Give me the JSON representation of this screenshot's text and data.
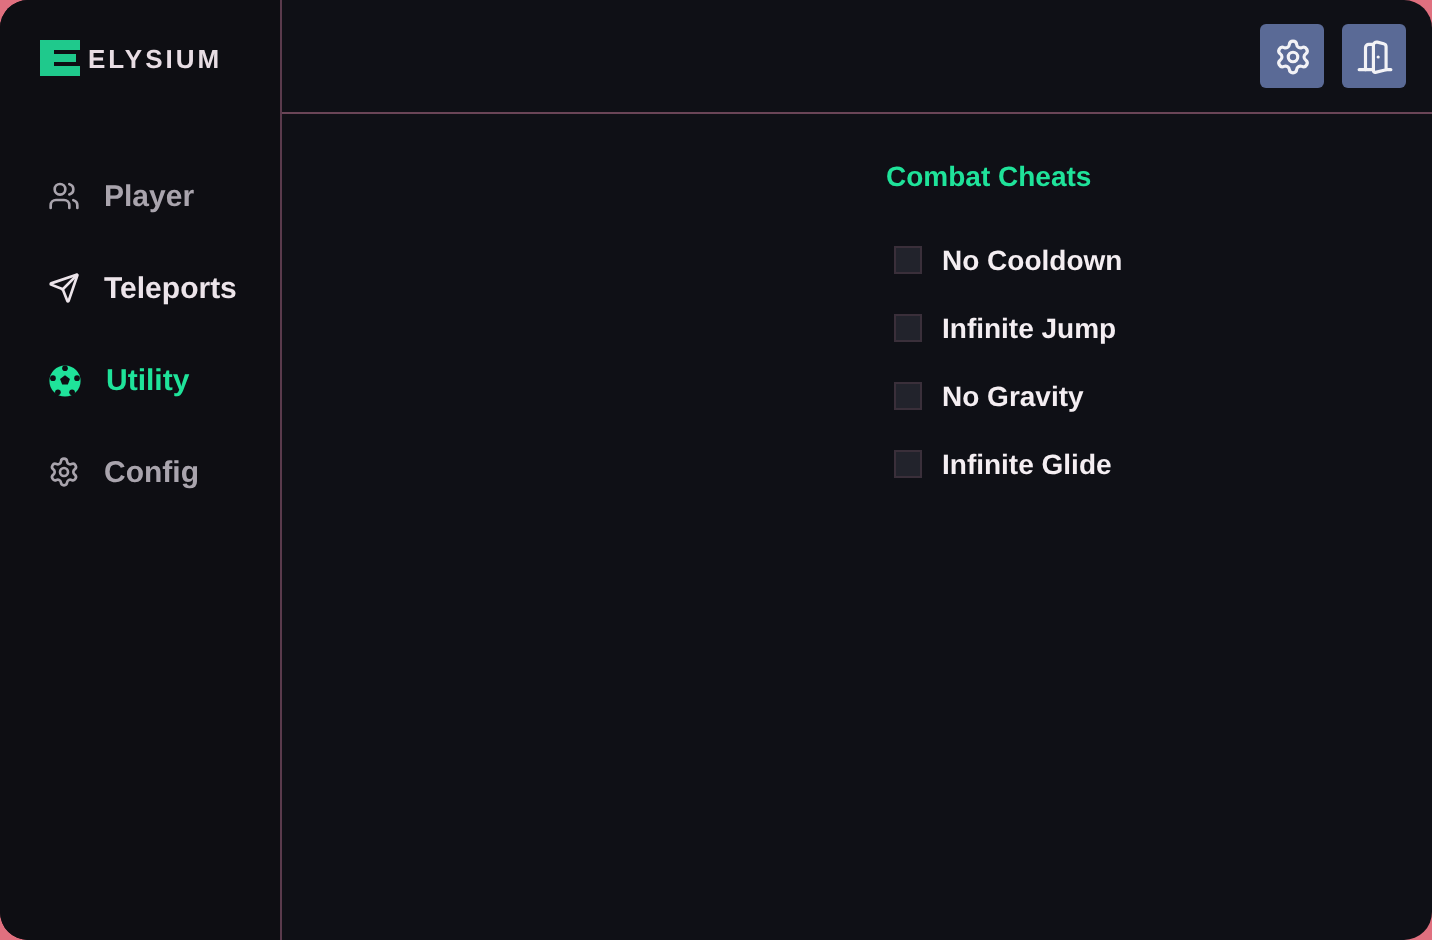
{
  "logo": {
    "text": "ELYSIUM"
  },
  "sidebar": {
    "items": [
      {
        "label": "Player",
        "kind": "people",
        "selected": false,
        "hovered": false
      },
      {
        "label": "Teleports",
        "kind": "plane",
        "selected": false,
        "hovered": true
      },
      {
        "label": "Utility",
        "kind": "ball",
        "selected": true,
        "hovered": false
      },
      {
        "label": "Config",
        "kind": "gear",
        "selected": false,
        "hovered": false
      }
    ]
  },
  "header": {
    "buttons": [
      {
        "kind": "settings"
      },
      {
        "kind": "exit"
      }
    ]
  },
  "section": {
    "title": "Combat Cheats",
    "options": [
      {
        "label": "No Cooldown",
        "checked": false
      },
      {
        "label": "Infinite Jump",
        "checked": false
      },
      {
        "label": "No Gravity",
        "checked": false
      },
      {
        "label": "Infinite Glide",
        "checked": false
      }
    ]
  }
}
